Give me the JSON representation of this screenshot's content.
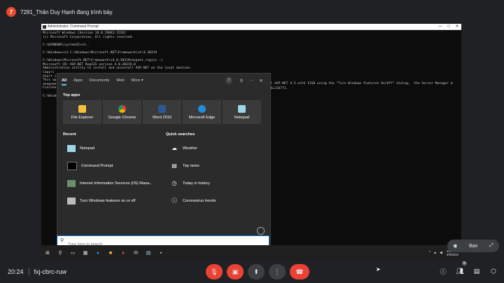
{
  "presenter": {
    "avatar_letter": "7",
    "label": "7281_Thân Duy Hạnh đang trình bày"
  },
  "cmd": {
    "title": "Administrator: Command Prompt",
    "controls": [
      "—",
      "□",
      "✕"
    ],
    "lines": [
      "Microsoft Windows [Version 10.0.19043.1526]",
      "(c) Microsoft Corporation. All rights reserved.",
      "",
      "C:\\WINDOWS\\system32>cd..",
      "",
      "C:\\Windows>cd C:\\Windows\\Microsoft.NET\\Framework\\v4.0.30319",
      "",
      "C:\\Windows\\Microsoft.NET\\Framework\\v4.0.30319>aspnet_regiis -i",
      "Microsoft (R) ASP.NET RegIIS version 4.0.30319.0",
      "Administration utility to install and uninstall ASP.NET on the local machine.",
      "Copyri",
      "Start i",
      "This op",
      "anageme",
      "Finishe",
      "",
      "C:\\Windo"
    ],
    "right_line_1": "all ASP.NET 4.5 with IIS8 using the \"Turn Windows Features On/Off\" dialog,  the Server Manager m",
    "right_line_2": "nID=216771."
  },
  "start_menu": {
    "tabs": [
      {
        "label": "All",
        "active": true
      },
      {
        "label": "Apps",
        "active": false
      },
      {
        "label": "Documents",
        "active": false
      },
      {
        "label": "Web",
        "active": false
      },
      {
        "label": "More ▾",
        "active": false
      }
    ],
    "account_letter": "T",
    "more_icons": [
      "⚲",
      "···",
      "✕"
    ],
    "top_apps_heading": "Top apps",
    "top_apps": [
      {
        "label": "File Explorer",
        "color": "#f3c13a"
      },
      {
        "label": "Google Chrome",
        "color": "#db4437"
      },
      {
        "label": "Word 2016",
        "color": "#2b5797"
      },
      {
        "label": "Microsoft Edge",
        "color": "#1e90d8"
      },
      {
        "label": "Notepad",
        "color": "#9fd5e8"
      }
    ],
    "recent_heading": "Recent",
    "recent": [
      {
        "label": "Notepad",
        "icon": "notepad-icon"
      },
      {
        "label": "Command Prompt",
        "icon": "cmd-icon"
      },
      {
        "label": "Internet Information Services (IIS) Mana...",
        "icon": "iis-icon"
      },
      {
        "label": "Turn Windows features on or off",
        "icon": "features-icon"
      }
    ],
    "quick_heading": "Quick searches",
    "quick": [
      {
        "label": "Weather",
        "icon": "☁"
      },
      {
        "label": "Top news",
        "icon": "▤"
      },
      {
        "label": "Today in history",
        "icon": "◷"
      },
      {
        "label": "Coronavirus trends",
        "icon": "ⓘ"
      }
    ],
    "search_placeholder": "Type here to search"
  },
  "taskbar": {
    "time": "8:24 PM",
    "date": "3/9/2022"
  },
  "meet": {
    "time": "20:24",
    "code": "fxj-cbrc-ruw",
    "pin_label": "Bạn",
    "participants_count": "5"
  }
}
